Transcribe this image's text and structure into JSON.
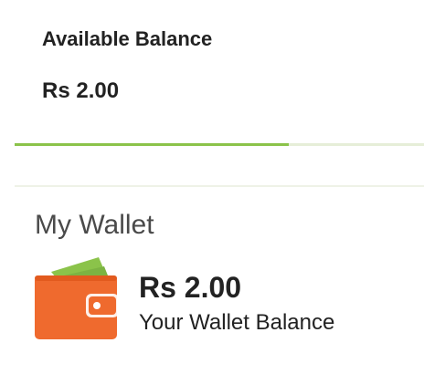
{
  "balance_card": {
    "title": "Available Balance",
    "amount": "Rs 2.00",
    "progress_fraction": 0.67,
    "progress_color": "#8bc34a"
  },
  "wallet": {
    "heading": "My Wallet",
    "amount": "Rs 2.00",
    "caption": "Your Wallet Balance",
    "icon": "wallet-icon",
    "icon_color": "#ef6a2e",
    "icon_accent_color": "#8bc34a"
  }
}
